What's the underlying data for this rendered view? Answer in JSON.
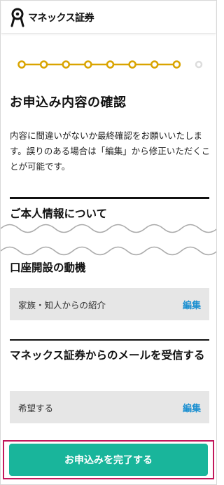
{
  "header": {
    "brand": "マネックス証券",
    "logo_icon": "monex-logo-icon"
  },
  "progress": {
    "total_steps": 9,
    "completed_steps": 8,
    "accent": "#d9a400",
    "inactive": "#dddddd"
  },
  "page": {
    "title": "お申込み内容の確認",
    "description": "内容に間違いがないか最終確認をお願いいたします。誤りのある場合は「編集」から修正いただくことが可能です。"
  },
  "sections": [
    {
      "heading": "ご本人情報について"
    },
    {
      "heading": "口座開設の動機",
      "value": "家族・知人からの紹介",
      "edit_label": "編集"
    },
    {
      "heading": "マネックス証券からのメールを受信する",
      "value": "希望する",
      "edit_label": "編集"
    }
  ],
  "cta": {
    "label": "お申込みを完了する",
    "color": "#19b59b",
    "highlight": "#c2185b"
  }
}
